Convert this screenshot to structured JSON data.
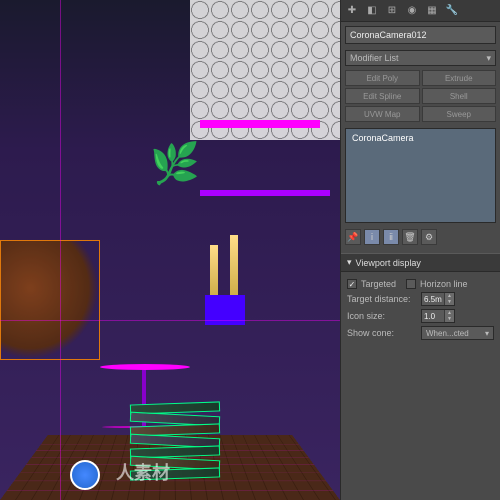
{
  "objectName": "CoronaCamera012",
  "modifierDropdown": "Modifier List",
  "modifierButtons": {
    "editPoly": "Edit Poly",
    "extrude": "Extrude",
    "editSpline": "Edit Spline",
    "shell": "Shell",
    "uvwMap": "UVW Map",
    "sweep": "Sweep"
  },
  "stackItem": "CoronaCamera",
  "rollout": {
    "title": "Viewport display",
    "targeted": {
      "label": "Targeted",
      "checked": true
    },
    "horizonLine": {
      "label": "Horizon line",
      "checked": false
    },
    "targetDistance": {
      "label": "Target distance:",
      "value": "6.5m"
    },
    "iconSize": {
      "label": "Icon size:",
      "value": "1.0"
    },
    "showCone": {
      "label": "Show cone:",
      "value": "When...cted"
    }
  },
  "watermark": "人素材"
}
